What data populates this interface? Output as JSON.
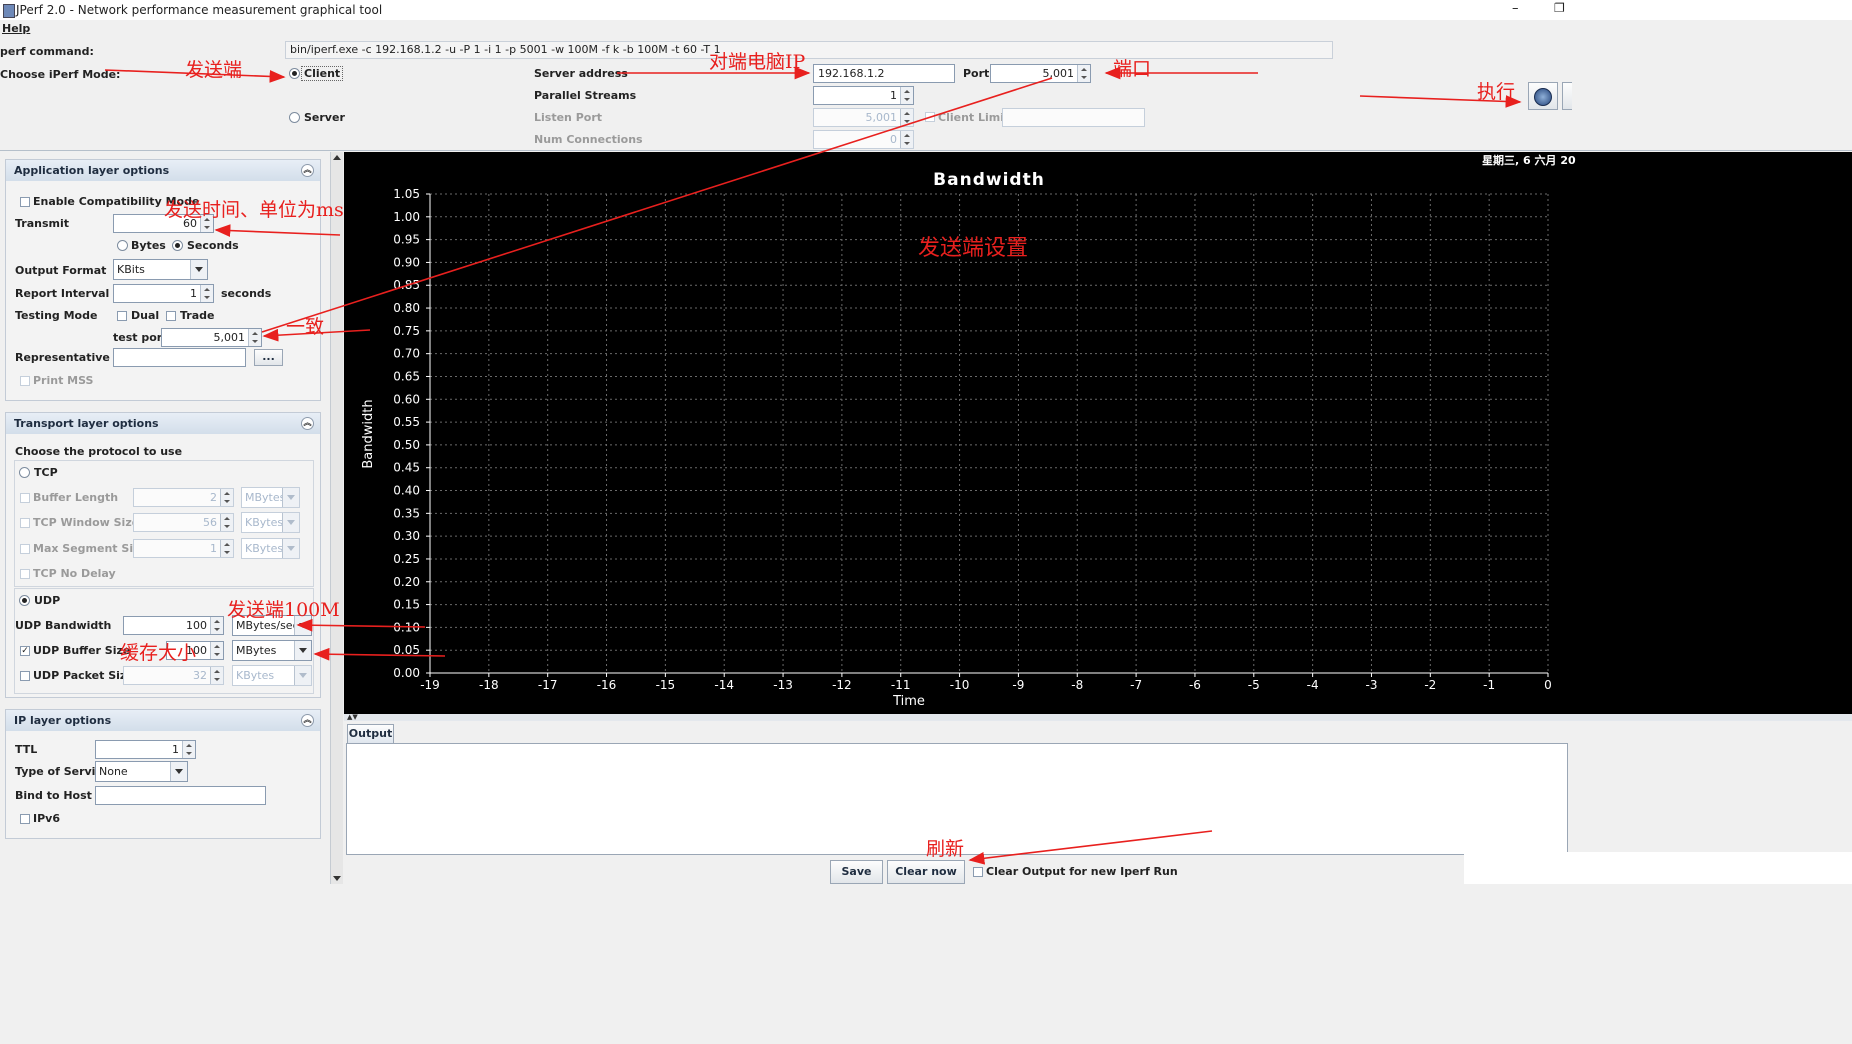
{
  "window": {
    "title": "JPerf 2.0 - Network performance measurement graphical tool",
    "minimize": "–",
    "restore": "❐"
  },
  "menu": {
    "help": "Help"
  },
  "top": {
    "iperf_command_label": "perf command:",
    "iperf_command_value": "bin/iperf.exe -c 192.168.1.2 -u -P 1 -i 1 -p 5001 -w 100M -f k -b 100M -t 60 -T 1",
    "mode_label": "Choose iPerf Mode:",
    "client_label": "Client",
    "server_label": "Server",
    "server_address_label": "Server address",
    "server_address_value": "192.168.1.2",
    "port_label": "Port",
    "port_value": "5,001",
    "parallel_label": "Parallel Streams",
    "parallel_value": "1",
    "listen_port_label": "Listen Port",
    "listen_port_value": "5,001",
    "client_limit_label": "Client Limit",
    "num_connections_label": "Num Connections",
    "num_connections_value": "0"
  },
  "app_layer": {
    "title": "Application layer options",
    "compat_label": "Enable Compatibility Mode",
    "transmit_label": "Transmit",
    "transmit_value": "60",
    "bytes_label": "Bytes",
    "seconds_label": "Seconds",
    "output_format_label": "Output Format",
    "output_format_value": "KBits",
    "report_interval_label": "Report Interval",
    "report_interval_value": "1",
    "seconds_unit": "seconds",
    "testing_mode_label": "Testing Mode",
    "dual_label": "Dual",
    "trade_label": "Trade",
    "test_port_label": "test port",
    "test_port_value": "5,001",
    "rep_file_label": "Representative File",
    "browse_label": "...",
    "print_mss_label": "Print MSS"
  },
  "transport_layer": {
    "title": "Transport layer options",
    "choose_label": "Choose the protocol to use",
    "tcp_label": "TCP",
    "buffer_length_label": "Buffer Length",
    "buffer_length_value": "2",
    "buffer_length_unit": "MBytes",
    "window_size_label": "TCP Window Size",
    "window_size_value": "56",
    "window_size_unit": "KBytes",
    "max_seg_label": "Max Segment Size",
    "max_seg_value": "1",
    "max_seg_unit": "KBytes",
    "no_delay_label": "TCP No Delay",
    "udp_label": "UDP",
    "udp_bw_label": "UDP Bandwidth",
    "udp_bw_value": "100",
    "udp_bw_unit": "MBytes/sec",
    "udp_buf_label": "UDP Buffer Size",
    "udp_buf_value": "100",
    "udp_buf_unit": "MBytes",
    "udp_pkt_label": "UDP Packet Size",
    "udp_pkt_value": "32",
    "udp_pkt_unit": "KBytes"
  },
  "ip_layer": {
    "title": "IP layer options",
    "ttl_label": "TTL",
    "ttl_value": "1",
    "tos_label": "Type of Service",
    "tos_value": "None",
    "bind_label": "Bind to Host",
    "ipv6_label": "IPv6"
  },
  "graph": {
    "date_text": "星期三, 6 六月 20"
  },
  "chart_data": {
    "type": "line",
    "title": "Bandwidth",
    "xlabel": "Time",
    "ylabel": "Bandwidth",
    "x_ticks": [
      "-19",
      "-18",
      "-17",
      "-16",
      "-15",
      "-14",
      "-13",
      "-12",
      "-11",
      "-10",
      "-9",
      "-8",
      "-7",
      "-6",
      "-5",
      "-4",
      "-3",
      "-2",
      "-1",
      "0"
    ],
    "y_ticks": [
      "0.00",
      "0.05",
      "0.10",
      "0.15",
      "0.20",
      "0.25",
      "0.30",
      "0.35",
      "0.40",
      "0.45",
      "0.50",
      "0.55",
      "0.60",
      "0.65",
      "0.70",
      "0.75",
      "0.80",
      "0.85",
      "0.90",
      "0.95",
      "1.00",
      "1.05"
    ],
    "xlim": [
      -19,
      0
    ],
    "ylim": [
      0,
      1.05
    ],
    "grid": true,
    "series": [],
    "background": "#000000",
    "foreground": "#ffffff"
  },
  "output": {
    "tab_label": "Output",
    "save_label": "Save",
    "clear_now_label": "Clear now",
    "clear_output_label": "Clear Output for new Iperf Run"
  },
  "annotations": {
    "sender": "发送端",
    "peer_ip": "对端电脑IP",
    "port": "端口",
    "execute": "执行",
    "send_time": "发送时间、单位为ms",
    "sender_settings": "发送端设置",
    "consistent": "一致",
    "sender_100m": "发送端100M",
    "buffer_size": "缓存大小",
    "refresh": "刷新"
  },
  "colors": {
    "annotation": "#e8201e",
    "graph_bg": "#000000",
    "panel_head": "#d3deea"
  }
}
